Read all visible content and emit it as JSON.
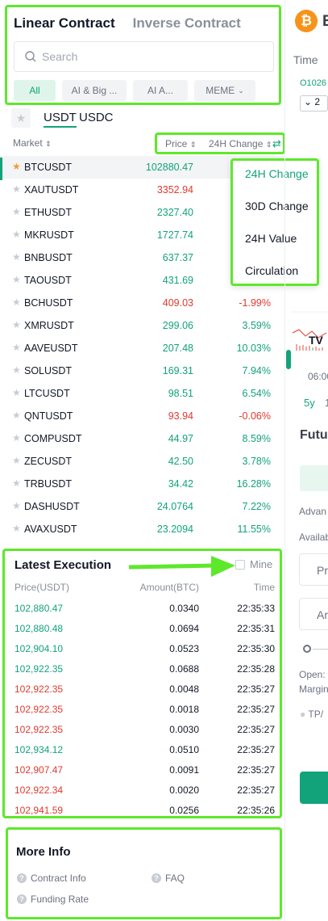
{
  "contract_tabs": {
    "linear": "Linear Contract",
    "inverse": "Inverse Contract"
  },
  "search": {
    "placeholder": "Search"
  },
  "categories": [
    "All",
    "AI & Big ...",
    "AI A...",
    "MEME"
  ],
  "currency_tabs": {
    "usdt": "USDT",
    "usdc": "USDC"
  },
  "market_header": {
    "market": "Market",
    "price": "Price",
    "change": "24H Change"
  },
  "sort_menu": [
    "24H Change",
    "30D Change",
    "24H Value",
    "Circulation"
  ],
  "markets": [
    {
      "symbol": "BTCUSDT",
      "price": "102880.47",
      "change": "",
      "dir": "up"
    },
    {
      "symbol": "XAUTUSDT",
      "price": "3352.94",
      "change": "",
      "dir": "down"
    },
    {
      "symbol": "ETHUSDT",
      "price": "2327.40",
      "change": "",
      "dir": "up"
    },
    {
      "symbol": "MKRUSDT",
      "price": "1727.74",
      "change": "",
      "dir": "up"
    },
    {
      "symbol": "BNBUSDT",
      "price": "637.37",
      "change": "",
      "dir": "up"
    },
    {
      "symbol": "TAOUSDT",
      "price": "431.69",
      "change": "",
      "dir": "up"
    },
    {
      "symbol": "BCHUSDT",
      "price": "409.03",
      "change": "-1.99%",
      "dir": "down"
    },
    {
      "symbol": "XMRUSDT",
      "price": "299.06",
      "change": "3.59%",
      "dir": "up"
    },
    {
      "symbol": "AAVEUSDT",
      "price": "207.48",
      "change": "10.03%",
      "dir": "up"
    },
    {
      "symbol": "SOLUSDT",
      "price": "169.31",
      "change": "7.94%",
      "dir": "up"
    },
    {
      "symbol": "LTCUSDT",
      "price": "98.51",
      "change": "6.54%",
      "dir": "up"
    },
    {
      "symbol": "QNTUSDT",
      "price": "93.94",
      "change": "-0.06%",
      "dir": "down"
    },
    {
      "symbol": "COMPUSDT",
      "price": "44.97",
      "change": "8.59%",
      "dir": "up"
    },
    {
      "symbol": "ZECUSDT",
      "price": "42.50",
      "change": "3.78%",
      "dir": "up"
    },
    {
      "symbol": "TRBUSDT",
      "price": "34.42",
      "change": "16.28%",
      "dir": "up"
    },
    {
      "symbol": "DASHUSDT",
      "price": "24.0764",
      "change": "7.22%",
      "dir": "up"
    },
    {
      "symbol": "AVAXUSDT",
      "price": "23.2094",
      "change": "11.55%",
      "dir": "up"
    }
  ],
  "execution": {
    "title": "Latest Execution",
    "mine_label": "Mine",
    "headers": {
      "price": "Price(USDT)",
      "amount": "Amount(BTC)",
      "time": "Time"
    },
    "rows": [
      {
        "price": "102,880.47",
        "amount": "0.0340",
        "time": "22:35:33",
        "dir": "up"
      },
      {
        "price": "102,880.48",
        "amount": "0.0694",
        "time": "22:35:31",
        "dir": "up"
      },
      {
        "price": "102,904.10",
        "amount": "0.0523",
        "time": "22:35:30",
        "dir": "up"
      },
      {
        "price": "102,922.35",
        "amount": "0.0688",
        "time": "22:35:28",
        "dir": "up"
      },
      {
        "price": "102,922.35",
        "amount": "0.0048",
        "time": "22:35:27",
        "dir": "down"
      },
      {
        "price": "102,922.35",
        "amount": "0.0018",
        "time": "22:35:27",
        "dir": "down"
      },
      {
        "price": "102,922.35",
        "amount": "0.0030",
        "time": "22:35:27",
        "dir": "down"
      },
      {
        "price": "102,934.12",
        "amount": "0.0510",
        "time": "22:35:27",
        "dir": "up"
      },
      {
        "price": "102,907.47",
        "amount": "0.0091",
        "time": "22:35:27",
        "dir": "down"
      },
      {
        "price": "102,922.34",
        "amount": "0.0020",
        "time": "22:35:27",
        "dir": "down"
      },
      {
        "price": "102,941.59",
        "amount": "0.0256",
        "time": "22:35:26",
        "dir": "down"
      }
    ]
  },
  "more_info": {
    "title": "More Info",
    "links": [
      "Contract Info",
      "FAQ",
      "Funding Rate"
    ]
  },
  "right_peek": {
    "symbol_initial": "B",
    "time_label": "Time",
    "order_id": "O1026",
    "dropdown": "2",
    "chart_logo": "TV",
    "time_tick": "06:00",
    "period_1": "5y",
    "period_2": "1",
    "futures": "Futu",
    "advanced": "Advan",
    "available": "Availab",
    "price_label": "Pr",
    "amount_label": "Ar",
    "open_label": "Open:",
    "margin_label": "Margin",
    "tp_label": "TP/"
  },
  "colors": {
    "accent": "#12a37a",
    "down": "#e0392f",
    "highlight": "#5ee82b",
    "star": "#f29b38"
  }
}
